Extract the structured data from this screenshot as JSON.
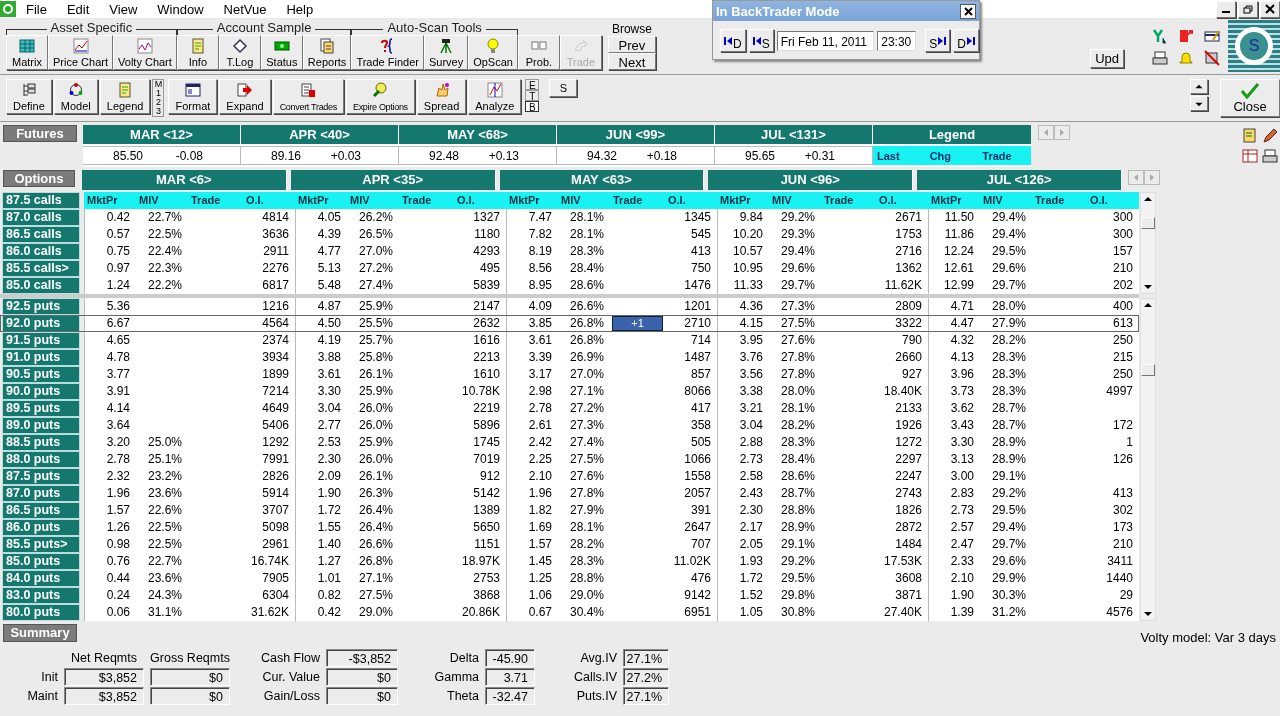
{
  "menu": [
    "File",
    "Edit",
    "View",
    "Window",
    "NetVue",
    "Help"
  ],
  "toolbar_groups": [
    {
      "title": "Asset Specific",
      "buttons": [
        {
          "label": "Matrix",
          "disabled": false
        },
        {
          "label": "Price Chart",
          "disabled": false
        },
        {
          "label": "Volty Chart",
          "disabled": false
        }
      ]
    },
    {
      "title": "Account Sample",
      "buttons": [
        {
          "label": "Info",
          "disabled": false
        },
        {
          "label": "T.Log",
          "disabled": false
        },
        {
          "label": "Status",
          "disabled": false
        },
        {
          "label": "Reports",
          "disabled": false
        }
      ]
    },
    {
      "title": "Auto-Scan Tools",
      "buttons": [
        {
          "label": "Trade Finder",
          "disabled": false
        },
        {
          "label": "Survey",
          "disabled": false
        },
        {
          "label": "OpScan",
          "disabled": false
        }
      ]
    },
    {
      "buttons": [
        {
          "label": "Prob.",
          "disabled": false
        },
        {
          "label": "Trade",
          "disabled": true
        }
      ]
    }
  ],
  "browse": {
    "title": "Browse",
    "buttons": [
      "Prev",
      "Next"
    ]
  },
  "upd_button": "Upd",
  "logo_letter": "S",
  "toolbar2": [
    "Define",
    "Model",
    "Legend",
    "Format",
    "Expand",
    "Convert Trades",
    "Expire Options",
    "Spread",
    "Analyze"
  ],
  "level_tabs": [
    "M",
    "1",
    "2",
    "3"
  ],
  "view_tabs": [
    {
      "label": "E",
      "selected": false
    },
    {
      "label": "T",
      "selected": false
    },
    {
      "label": "B",
      "selected": true
    }
  ],
  "s_button": "S",
  "close_button": "Close",
  "backtrader": {
    "title": "In BackTrader Mode",
    "back_buttons": [
      "D",
      "S"
    ],
    "date": "Fri Feb 11, 2011",
    "time": "23:30",
    "forward_buttons": [
      "S",
      "D"
    ]
  },
  "futures": {
    "title": "Futures",
    "months": [
      {
        "name": "MAR <12>",
        "last": "85.50",
        "chg": "-0.08"
      },
      {
        "name": "APR <40>",
        "last": "89.16",
        "chg": "+0.03"
      },
      {
        "name": "MAY <68>",
        "last": "92.48",
        "chg": "+0.13"
      },
      {
        "name": "JUN <99>",
        "last": "94.32",
        "chg": "+0.18"
      },
      {
        "name": "JUL <131>",
        "last": "95.65",
        "chg": "+0.31"
      }
    ],
    "legend": {
      "title": "Legend",
      "items": [
        "Last",
        "Chg",
        "Trade"
      ]
    }
  },
  "options": {
    "title": "Options",
    "first_strike": "87.5 calls",
    "months": [
      {
        "name": "MAR <6>",
        "columns": [
          "MktPr",
          "MIV",
          "Trade",
          "O.I."
        ]
      },
      {
        "name": "APR <35>",
        "columns": [
          "MktPr",
          "MIV",
          "Trade",
          "O.I."
        ]
      },
      {
        "name": "MAY <63>",
        "columns": [
          "MktPr",
          "MIV",
          "Trade",
          "O.I."
        ]
      },
      {
        "name": "JUN <96>",
        "columns": [
          "MktPr",
          "MIV",
          "Trade",
          "O.I."
        ]
      },
      {
        "name": "JUL <126>",
        "columns": [
          "MktPr",
          "MIV",
          "Trade",
          "O.I."
        ]
      }
    ],
    "calls": [
      {
        "strike": "87.0 calls",
        "selected": false,
        "cells": [
          [
            "0.42",
            "22.7%",
            null,
            "4814"
          ],
          [
            "4.05",
            "26.2%",
            null,
            "1327"
          ],
          [
            "7.47",
            "28.1%",
            null,
            "1345"
          ],
          [
            "9.84",
            "29.2%",
            null,
            "2671"
          ],
          [
            "11.50",
            "29.4%",
            null,
            "300"
          ]
        ]
      },
      {
        "strike": "86.5 calls",
        "selected": false,
        "cells": [
          [
            "0.57",
            "22.5%",
            null,
            "3636"
          ],
          [
            "4.39",
            "26.5%",
            null,
            "1180"
          ],
          [
            "7.82",
            "28.1%",
            null,
            "545"
          ],
          [
            "10.20",
            "29.3%",
            null,
            "1753"
          ],
          [
            "11.86",
            "29.4%",
            null,
            "300"
          ]
        ]
      },
      {
        "strike": "86.0 calls",
        "selected": false,
        "cells": [
          [
            "0.75",
            "22.4%",
            null,
            "2911"
          ],
          [
            "4.77",
            "27.0%",
            null,
            "4293"
          ],
          [
            "8.19",
            "28.3%",
            null,
            "413"
          ],
          [
            "10.57",
            "29.4%",
            null,
            "2716"
          ],
          [
            "12.24",
            "29.5%",
            null,
            "157"
          ]
        ]
      },
      {
        "strike": "85.5 calls>",
        "selected": false,
        "cells": [
          [
            "0.97",
            "22.3%",
            null,
            "2276"
          ],
          [
            "5.13",
            "27.2%",
            null,
            "495"
          ],
          [
            "8.56",
            "28.4%",
            null,
            "750"
          ],
          [
            "10.95",
            "29.6%",
            null,
            "1362"
          ],
          [
            "12.61",
            "29.6%",
            null,
            "210"
          ]
        ]
      },
      {
        "strike": "85.0 calls",
        "selected": false,
        "cells": [
          [
            "1.24",
            "22.2%",
            null,
            "6817"
          ],
          [
            "5.48",
            "27.4%",
            null,
            "5839"
          ],
          [
            "8.95",
            "28.6%",
            null,
            "1476"
          ],
          [
            "11.33",
            "29.7%",
            null,
            "11.62K"
          ],
          [
            "12.99",
            "29.7%",
            null,
            "202"
          ]
        ]
      }
    ],
    "puts": [
      {
        "strike": "92.5 puts",
        "selected": false,
        "cells": [
          [
            "5.36",
            null,
            null,
            "1216"
          ],
          [
            "4.87",
            "25.9%",
            null,
            "2147"
          ],
          [
            "4.09",
            "26.6%",
            null,
            "1201"
          ],
          [
            "4.36",
            "27.3%",
            null,
            "2809"
          ],
          [
            "4.71",
            "28.0%",
            null,
            "400"
          ]
        ]
      },
      {
        "strike": "92.0 puts",
        "selected": true,
        "cells": [
          [
            "6.67",
            null,
            null,
            "4564"
          ],
          [
            "4.50",
            "25.5%",
            null,
            "2632"
          ],
          [
            "3.85",
            "26.8%",
            "+1",
            "2710"
          ],
          [
            "4.15",
            "27.5%",
            null,
            "3322"
          ],
          [
            "4.47",
            "27.9%",
            null,
            "613"
          ]
        ]
      },
      {
        "strike": "91.5 puts",
        "selected": false,
        "cells": [
          [
            "4.65",
            null,
            null,
            "2374"
          ],
          [
            "4.19",
            "25.7%",
            null,
            "1616"
          ],
          [
            "3.61",
            "26.8%",
            null,
            "714"
          ],
          [
            "3.95",
            "27.6%",
            null,
            "790"
          ],
          [
            "4.32",
            "28.2%",
            null,
            "250"
          ]
        ]
      },
      {
        "strike": "91.0 puts",
        "selected": false,
        "cells": [
          [
            "4.78",
            null,
            null,
            "3934"
          ],
          [
            "3.88",
            "25.8%",
            null,
            "2213"
          ],
          [
            "3.39",
            "26.9%",
            null,
            "1487"
          ],
          [
            "3.76",
            "27.8%",
            null,
            "2660"
          ],
          [
            "4.13",
            "28.3%",
            null,
            "215"
          ]
        ]
      },
      {
        "strike": "90.5 puts",
        "selected": false,
        "cells": [
          [
            "3.77",
            null,
            null,
            "1899"
          ],
          [
            "3.61",
            "26.1%",
            null,
            "1610"
          ],
          [
            "3.17",
            "27.0%",
            null,
            "857"
          ],
          [
            "3.56",
            "27.8%",
            null,
            "927"
          ],
          [
            "3.96",
            "28.3%",
            null,
            "250"
          ]
        ]
      },
      {
        "strike": "90.0 puts",
        "selected": false,
        "cells": [
          [
            "3.91",
            null,
            null,
            "7214"
          ],
          [
            "3.30",
            "25.9%",
            null,
            "10.78K"
          ],
          [
            "2.98",
            "27.1%",
            null,
            "8066"
          ],
          [
            "3.38",
            "28.0%",
            null,
            "18.40K"
          ],
          [
            "3.73",
            "28.3%",
            null,
            "4997"
          ]
        ]
      },
      {
        "strike": "89.5 puts",
        "selected": false,
        "cells": [
          [
            "4.14",
            null,
            null,
            "4649"
          ],
          [
            "3.04",
            "26.0%",
            null,
            "2219"
          ],
          [
            "2.78",
            "27.2%",
            null,
            "417"
          ],
          [
            "3.21",
            "28.1%",
            null,
            "2133"
          ],
          [
            "3.62",
            "28.7%",
            null,
            null
          ]
        ]
      },
      {
        "strike": "89.0 puts",
        "selected": false,
        "cells": [
          [
            "3.64",
            null,
            null,
            "5406"
          ],
          [
            "2.77",
            "26.0%",
            null,
            "5896"
          ],
          [
            "2.61",
            "27.3%",
            null,
            "358"
          ],
          [
            "3.04",
            "28.2%",
            null,
            "1926"
          ],
          [
            "3.43",
            "28.7%",
            null,
            "172"
          ]
        ]
      },
      {
        "strike": "88.5 puts",
        "selected": false,
        "cells": [
          [
            "3.20",
            "25.0%",
            null,
            "1292"
          ],
          [
            "2.53",
            "25.9%",
            null,
            "1745"
          ],
          [
            "2.42",
            "27.4%",
            null,
            "505"
          ],
          [
            "2.88",
            "28.3%",
            null,
            "1272"
          ],
          [
            "3.30",
            "28.9%",
            null,
            "1"
          ]
        ]
      },
      {
        "strike": "88.0 puts",
        "selected": false,
        "cells": [
          [
            "2.78",
            "25.1%",
            null,
            "7991"
          ],
          [
            "2.30",
            "26.0%",
            null,
            "7019"
          ],
          [
            "2.25",
            "27.5%",
            null,
            "1066"
          ],
          [
            "2.73",
            "28.4%",
            null,
            "2297"
          ],
          [
            "3.13",
            "28.9%",
            null,
            "126"
          ]
        ]
      },
      {
        "strike": "87.5 puts",
        "selected": false,
        "cells": [
          [
            "2.32",
            "23.2%",
            null,
            "2826"
          ],
          [
            "2.09",
            "26.1%",
            null,
            "912"
          ],
          [
            "2.10",
            "27.6%",
            null,
            "1558"
          ],
          [
            "2.58",
            "28.6%",
            null,
            "2247"
          ],
          [
            "3.00",
            "29.1%",
            null,
            null
          ]
        ]
      },
      {
        "strike": "87.0 puts",
        "selected": false,
        "cells": [
          [
            "1.96",
            "23.6%",
            null,
            "5914"
          ],
          [
            "1.90",
            "26.3%",
            null,
            "5142"
          ],
          [
            "1.96",
            "27.8%",
            null,
            "2057"
          ],
          [
            "2.43",
            "28.7%",
            null,
            "2743"
          ],
          [
            "2.83",
            "29.2%",
            null,
            "413"
          ]
        ]
      },
      {
        "strike": "86.5 puts",
        "selected": false,
        "cells": [
          [
            "1.57",
            "22.6%",
            null,
            "3707"
          ],
          [
            "1.72",
            "26.4%",
            null,
            "1389"
          ],
          [
            "1.82",
            "27.9%",
            null,
            "391"
          ],
          [
            "2.30",
            "28.8%",
            null,
            "1826"
          ],
          [
            "2.73",
            "29.5%",
            null,
            "302"
          ]
        ]
      },
      {
        "strike": "86.0 puts",
        "selected": false,
        "cells": [
          [
            "1.26",
            "22.5%",
            null,
            "5098"
          ],
          [
            "1.55",
            "26.4%",
            null,
            "5650"
          ],
          [
            "1.69",
            "28.1%",
            null,
            "2647"
          ],
          [
            "2.17",
            "28.9%",
            null,
            "2872"
          ],
          [
            "2.57",
            "29.4%",
            null,
            "173"
          ]
        ]
      },
      {
        "strike": "85.5 puts>",
        "selected": false,
        "cells": [
          [
            "0.98",
            "22.5%",
            null,
            "2961"
          ],
          [
            "1.40",
            "26.6%",
            null,
            "1151"
          ],
          [
            "1.57",
            "28.2%",
            null,
            "707"
          ],
          [
            "2.05",
            "29.1%",
            null,
            "1484"
          ],
          [
            "2.47",
            "29.7%",
            null,
            "210"
          ]
        ]
      },
      {
        "strike": "85.0 puts",
        "selected": false,
        "cells": [
          [
            "0.76",
            "22.7%",
            null,
            "16.74K"
          ],
          [
            "1.27",
            "26.8%",
            null,
            "18.97K"
          ],
          [
            "1.45",
            "28.3%",
            null,
            "11.02K"
          ],
          [
            "1.93",
            "29.2%",
            null,
            "17.53K"
          ],
          [
            "2.33",
            "29.6%",
            null,
            "3411"
          ]
        ]
      },
      {
        "strike": "84.0 puts",
        "selected": false,
        "cells": [
          [
            "0.44",
            "23.6%",
            null,
            "7905"
          ],
          [
            "1.01",
            "27.1%",
            null,
            "2753"
          ],
          [
            "1.25",
            "28.8%",
            null,
            "476"
          ],
          [
            "1.72",
            "29.5%",
            null,
            "3608"
          ],
          [
            "2.10",
            "29.9%",
            null,
            "1440"
          ]
        ]
      },
      {
        "strike": "83.0 puts",
        "selected": false,
        "cells": [
          [
            "0.24",
            "24.3%",
            null,
            "6304"
          ],
          [
            "0.82",
            "27.5%",
            null,
            "3868"
          ],
          [
            "1.06",
            "29.0%",
            null,
            "9142"
          ],
          [
            "1.52",
            "29.8%",
            null,
            "3871"
          ],
          [
            "1.90",
            "30.3%",
            null,
            "29"
          ]
        ]
      },
      {
        "strike": "80.0 puts",
        "selected": false,
        "cells": [
          [
            "0.06",
            "31.1%",
            null,
            "31.62K"
          ],
          [
            "0.42",
            "29.0%",
            null,
            "20.86K"
          ],
          [
            "0.67",
            "30.4%",
            null,
            "6951"
          ],
          [
            "1.05",
            "30.8%",
            null,
            "27.40K"
          ],
          [
            "1.39",
            "31.2%",
            null,
            "4576"
          ]
        ]
      }
    ]
  },
  "summary": {
    "title": "Summary",
    "reqmts_headers": [
      "Net Reqmts",
      "Gross Reqmts"
    ],
    "reqmts": [
      {
        "label": "Init",
        "net": "$3,852",
        "gross": "$0"
      },
      {
        "label": "Maint",
        "net": "$3,852",
        "gross": "$0"
      }
    ],
    "stat_columns": [
      [
        {
          "label": "Cash Flow",
          "value": "-$3,852"
        },
        {
          "label": "Cur. Value",
          "value": "$0"
        },
        {
          "label": "Gain/Loss",
          "value": "$0"
        }
      ],
      [
        {
          "label": "Delta",
          "value": "-45.90"
        },
        {
          "label": "Gamma",
          "value": "3.71"
        },
        {
          "label": "Theta",
          "value": "-32.47"
        }
      ],
      [
        {
          "label": "Avg.IV",
          "value": "27.1%"
        },
        {
          "label": "Calls.IV",
          "value": "27.2%"
        },
        {
          "label": "Puts.IV",
          "value": "27.1%"
        }
      ]
    ]
  },
  "status": "Volty model: Var 3 days"
}
